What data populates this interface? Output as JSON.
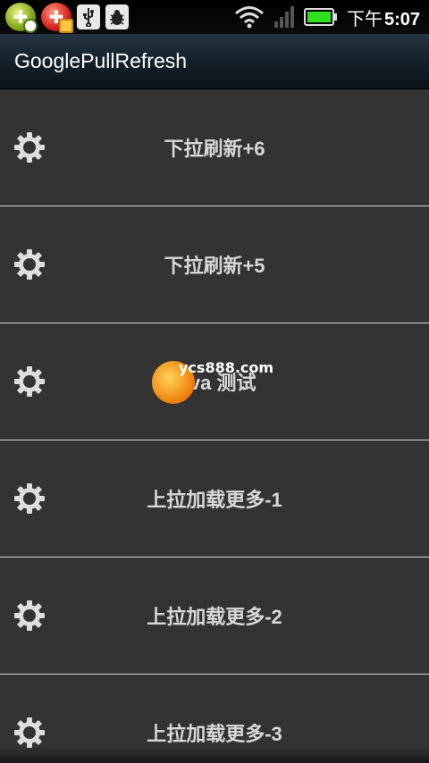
{
  "status_bar": {
    "time_prefix": "下午",
    "time": "5:07",
    "battery_color": "#2ee21f"
  },
  "app_bar": {
    "title": "GooglePullRefresh"
  },
  "list": {
    "items": [
      {
        "label": "下拉刷新+6"
      },
      {
        "label": "下拉刷新+5"
      },
      {
        "label": "java    测试"
      },
      {
        "label": "上拉加载更多-1"
      },
      {
        "label": "上拉加载更多-2"
      },
      {
        "label": "上拉加载更多-3"
      }
    ]
  },
  "watermark": {
    "text": "ycs888.com"
  },
  "colors": {
    "list_bg": "#333333",
    "divider": "#d8d8d8",
    "label": "#d8d8d8"
  }
}
